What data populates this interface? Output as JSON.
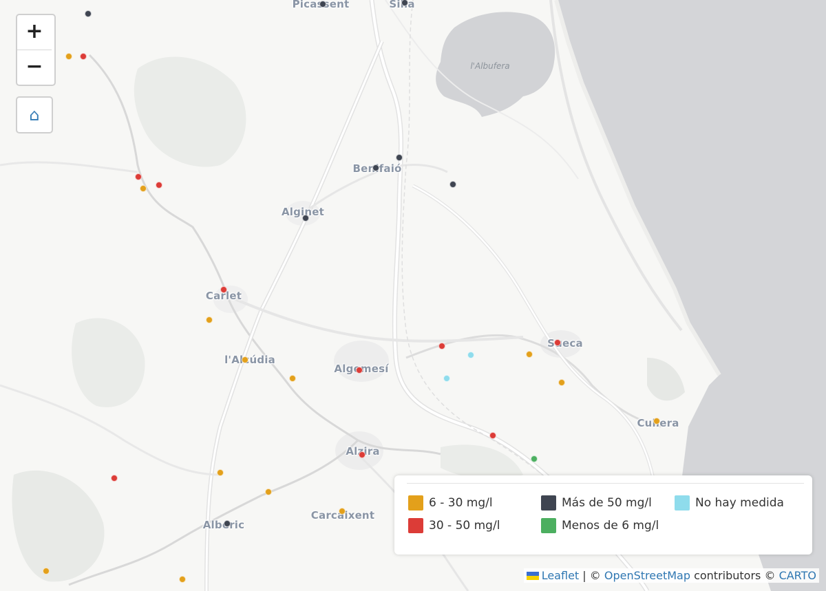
{
  "map": {
    "controls": {
      "zoom_in": "+",
      "zoom_out": "−",
      "home": "⌂"
    },
    "water_label": "l'Albufera",
    "places": [
      {
        "name": "Picassent",
        "pos": [
          466,
          6
        ]
      },
      {
        "name": "Silla",
        "pos": [
          584,
          6
        ]
      },
      {
        "name": "Benifaió",
        "pos": [
          548,
          245
        ]
      },
      {
        "name": "Alginet",
        "pos": [
          440,
          308
        ]
      },
      {
        "name": "Carlet",
        "pos": [
          325,
          430
        ]
      },
      {
        "name": "l'Alcúdia",
        "pos": [
          363,
          523
        ]
      },
      {
        "name": "Algemesí",
        "pos": [
          525,
          536
        ]
      },
      {
        "name": "Sueca",
        "pos": [
          821,
          499
        ]
      },
      {
        "name": "Cullera",
        "pos": [
          956,
          615
        ]
      },
      {
        "name": "Alzira",
        "pos": [
          527,
          656
        ]
      },
      {
        "name": "Carcaixent",
        "pos": [
          498,
          749
        ]
      },
      {
        "name": "Alberic",
        "pos": [
          325,
          763
        ]
      }
    ],
    "legend": {
      "items": [
        {
          "label": "6 - 30 mg/l",
          "color": "#e3a01b",
          "key": "6-30"
        },
        {
          "label": "30 - 50 mg/l",
          "color": "#dc3c37",
          "key": "30-50"
        },
        {
          "label": "Más de 50 mg/l",
          "color": "#3f4551",
          "key": "gt50"
        },
        {
          "label": "Menos de 6 mg/l",
          "color": "#4caf60",
          "key": "lt6"
        },
        {
          "label": "No hay medida",
          "color": "#8fdcec",
          "key": "none"
        }
      ]
    },
    "markers": [
      {
        "cat": "gt50",
        "pos": [
          128,
          20
        ]
      },
      {
        "cat": "6-30",
        "pos": [
          100,
          82
        ]
      },
      {
        "cat": "30-50",
        "pos": [
          121,
          82
        ]
      },
      {
        "cat": "gt50",
        "pos": [
          469,
          6
        ]
      },
      {
        "cat": "gt50",
        "pos": [
          588,
          4
        ]
      },
      {
        "cat": "30-50",
        "pos": [
          201,
          257
        ]
      },
      {
        "cat": "6-30",
        "pos": [
          208,
          274
        ]
      },
      {
        "cat": "30-50",
        "pos": [
          231,
          269
        ]
      },
      {
        "cat": "gt50",
        "pos": [
          580,
          229
        ]
      },
      {
        "cat": "gt50",
        "pos": [
          546,
          244
        ]
      },
      {
        "cat": "gt50",
        "pos": [
          658,
          268
        ]
      },
      {
        "cat": "gt50",
        "pos": [
          444,
          317
        ]
      },
      {
        "cat": "30-50",
        "pos": [
          325,
          421
        ]
      },
      {
        "cat": "6-30",
        "pos": [
          304,
          465
        ]
      },
      {
        "cat": "6-30",
        "pos": [
          356,
          523
        ]
      },
      {
        "cat": "6-30",
        "pos": [
          425,
          550
        ]
      },
      {
        "cat": "30-50",
        "pos": [
          522,
          538
        ]
      },
      {
        "cat": "30-50",
        "pos": [
          642,
          503
        ]
      },
      {
        "cat": "none",
        "pos": [
          684,
          516
        ]
      },
      {
        "cat": "none",
        "pos": [
          649,
          550
        ]
      },
      {
        "cat": "6-30",
        "pos": [
          769,
          515
        ]
      },
      {
        "cat": "30-50",
        "pos": [
          810,
          498
        ]
      },
      {
        "cat": "6-30",
        "pos": [
          816,
          556
        ]
      },
      {
        "cat": "6-30",
        "pos": [
          954,
          612
        ]
      },
      {
        "cat": "30-50",
        "pos": [
          716,
          633
        ]
      },
      {
        "cat": "lt6",
        "pos": [
          776,
          667
        ]
      },
      {
        "cat": "30-50",
        "pos": [
          526,
          661
        ]
      },
      {
        "cat": "30-50",
        "pos": [
          166,
          695
        ]
      },
      {
        "cat": "6-30",
        "pos": [
          320,
          687
        ]
      },
      {
        "cat": "6-30",
        "pos": [
          390,
          715
        ]
      },
      {
        "cat": "6-30",
        "pos": [
          497,
          743
        ]
      },
      {
        "cat": "gt50",
        "pos": [
          330,
          761
        ]
      },
      {
        "cat": "6-30",
        "pos": [
          67,
          830
        ]
      },
      {
        "cat": "6-30",
        "pos": [
          265,
          842
        ]
      }
    ],
    "attribution": {
      "leaflet": "Leaflet",
      "sep": "|",
      "copy1": "©",
      "osm": "OpenStreetMap",
      "contributors": "contributors",
      "copy2": "©",
      "carto": "CARTO"
    }
  }
}
